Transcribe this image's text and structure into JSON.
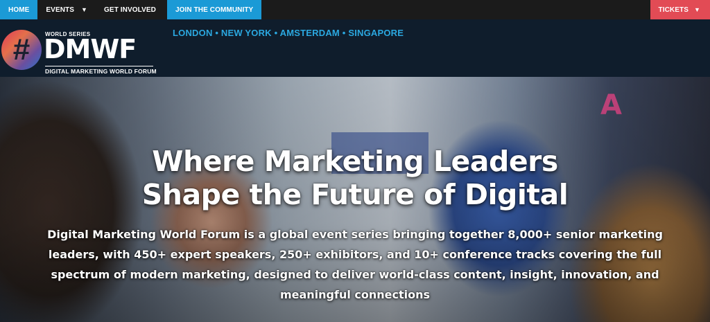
{
  "nav": {
    "home": "HOME",
    "events": "EVENTS",
    "get_involved": "GET INVOLVED",
    "join_community": "JOIN THE COMMUNITY",
    "tickets": "TICKETS",
    "caret_icon": "chevron-down-icon"
  },
  "brand": {
    "hash_symbol": "#",
    "world_series": "WORLD SERIES",
    "acronym": "DMWF",
    "full_name": "DIGITAL MARKETING WORLD FORUM",
    "cities": "LONDON • NEW YORK • AMSTERDAM • SINGAPORE"
  },
  "hero": {
    "headline_line1": "Where Marketing Leaders",
    "headline_line2": "Shape the Future of Digital",
    "description": "Digital Marketing World Forum is a global event series bringing together 8,000+ senior marketing leaders, with 450+ expert speakers, 250+ exhibitors, and 10+ conference tracks covering the full spectrum of modern marketing, designed to deliver world-class content, insight, innovation, and meaningful connections"
  },
  "colors": {
    "nav_bg": "#1b1b1b",
    "accent_blue": "#1b9ad6",
    "tickets_red": "#e24b55",
    "brand_bg": "#0f1d2c",
    "cities_blue": "#2ba8e0"
  }
}
